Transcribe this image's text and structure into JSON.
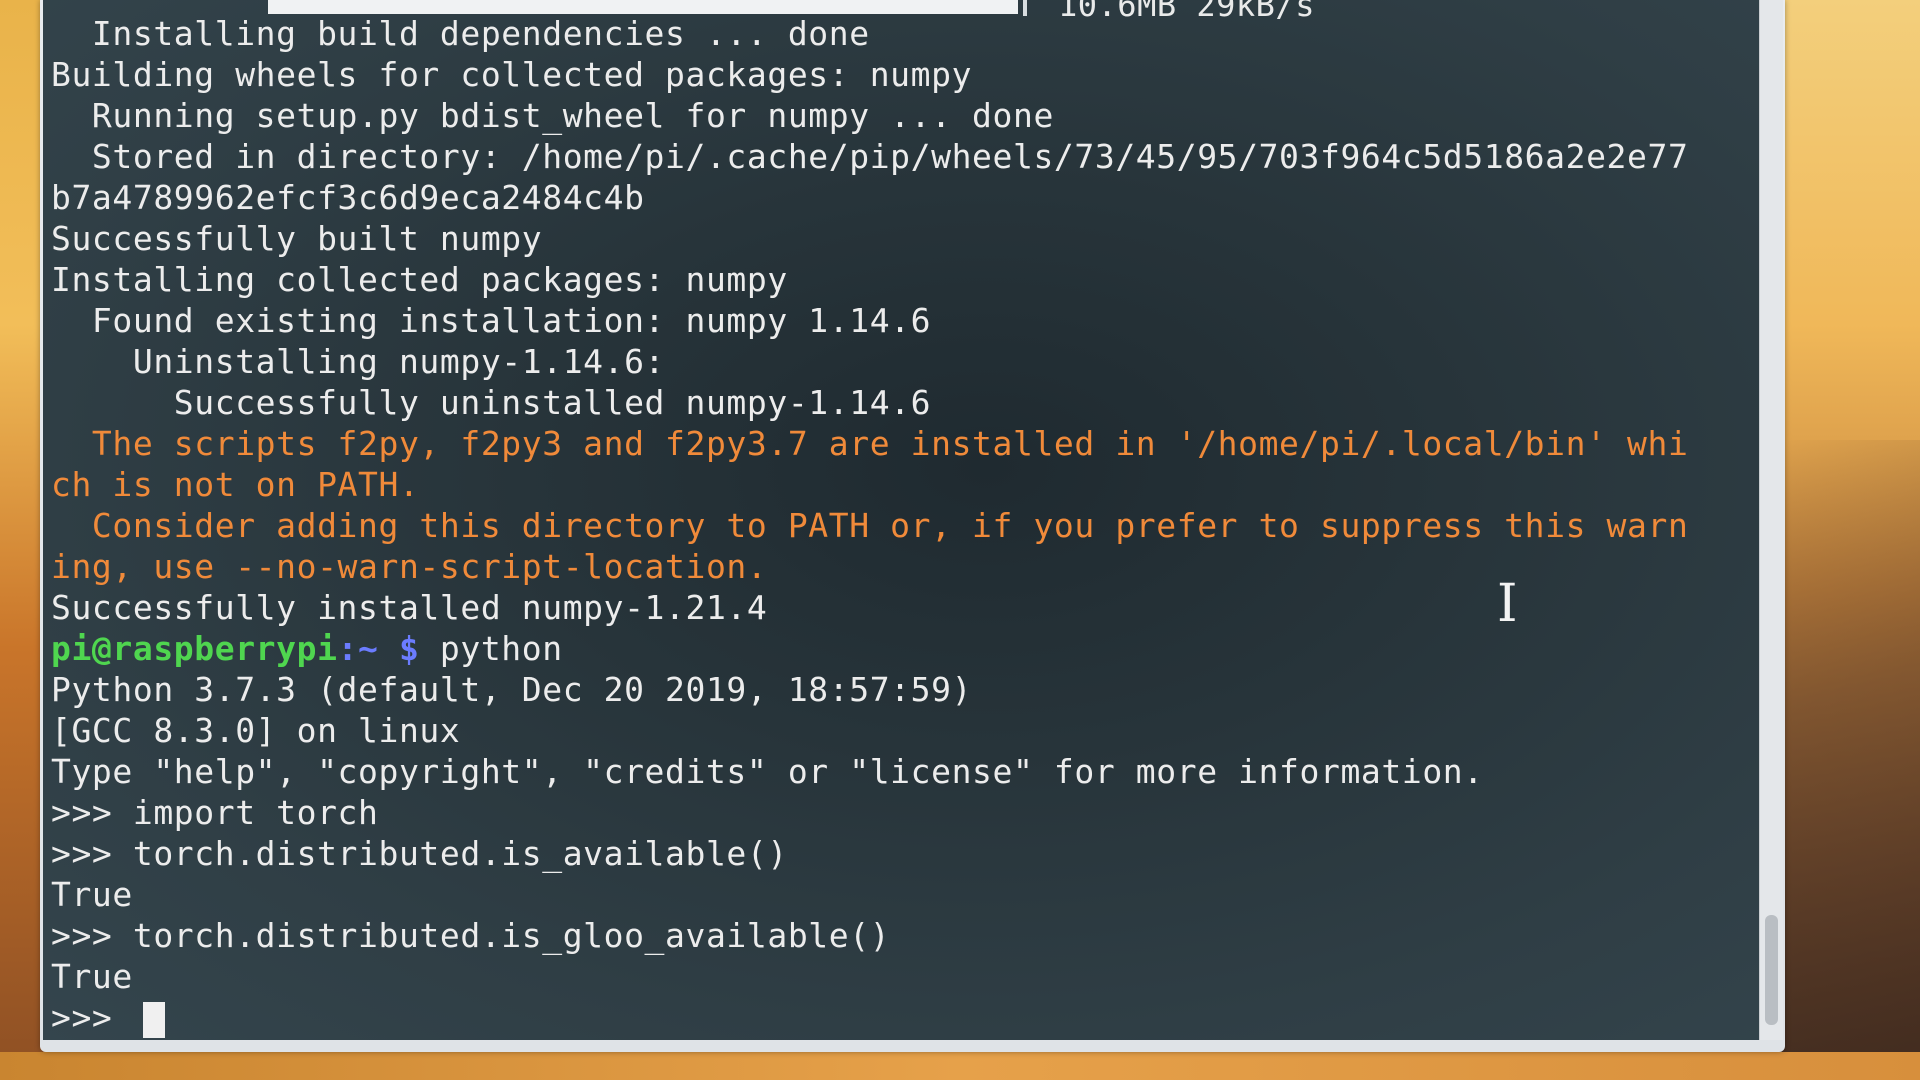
{
  "header": {
    "progress_stat": "10.6MB 29kB/s"
  },
  "lines": [
    "  Installing build dependencies ... done",
    "Building wheels for collected packages: numpy",
    "  Running setup.py bdist_wheel for numpy ... done",
    "  Stored in directory: /home/pi/.cache/pip/wheels/73/45/95/703f964c5d5186a2e2e77",
    "b7a4789962efcf3c6d9eca2484c4b",
    "Successfully built numpy",
    "Installing collected packages: numpy",
    "  Found existing installation: numpy 1.14.6",
    "    Uninstalling numpy-1.14.6:",
    "      Successfully uninstalled numpy-1.14.6",
    "  The scripts f2py, f2py3 and f2py3.7 are installed in '/home/pi/.local/bin' whi",
    "ch is not on PATH.",
    "  Consider adding this directory to PATH or, if you prefer to suppress this warn",
    "ing, use --no-warn-script-location.",
    "Successfully installed numpy-1.21.4"
  ],
  "prompt": {
    "user_host": "pi@raspberrypi",
    "path": ":~ $",
    "command": " python"
  },
  "python_lines": [
    "Python 3.7.3 (default, Dec 20 2019, 18:57:59)",
    "[GCC 8.3.0] on linux",
    "Type \"help\", \"copyright\", \"credits\" or \"license\" for more information.",
    ">>> import torch",
    ">>> torch.distributed.is_available()",
    "True",
    ">>> torch.distributed.is_gloo_available()",
    "True"
  ],
  "final_prompt": ">>> ",
  "ibeam_glyph": "I",
  "colors": {
    "text": "#ececec",
    "warning": "#f08a3a",
    "prompt_user": "#4fd64f",
    "prompt_path": "#6b7cff",
    "background": "#27343a"
  }
}
